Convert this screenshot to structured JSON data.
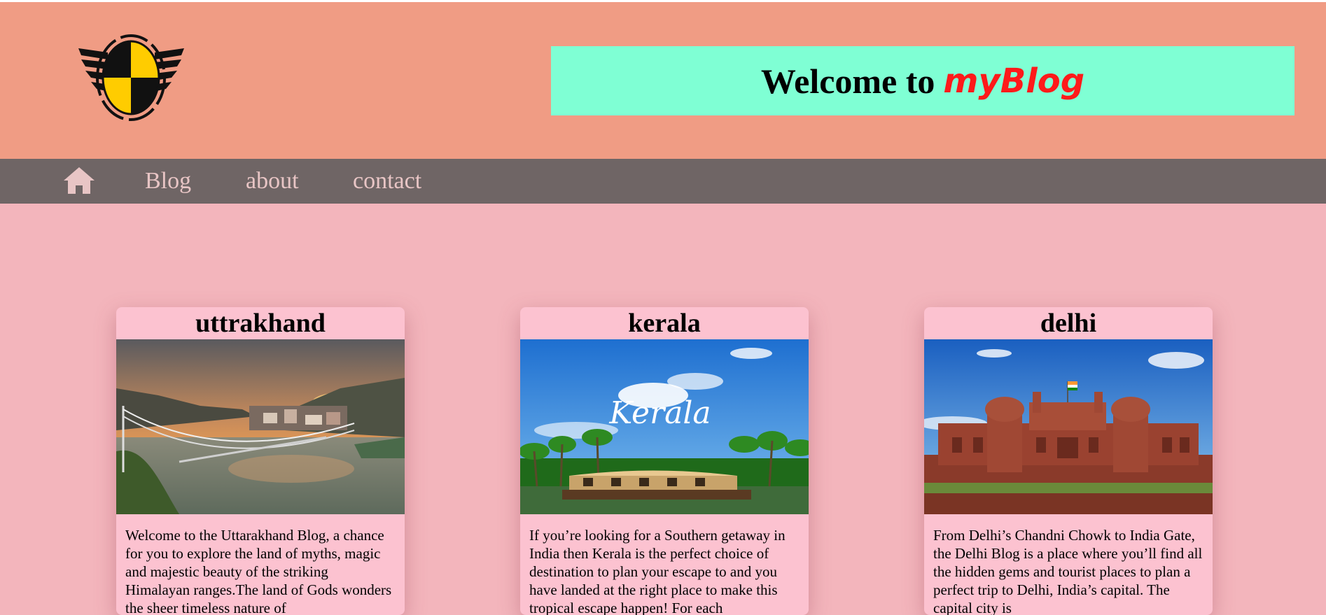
{
  "header": {
    "welcome_text": "Welcome to",
    "brand_name": "myBlog",
    "colors": {
      "header_bg": "#f09c84",
      "banner_bg": "#7fffd4",
      "brand": "#ff1a1a"
    }
  },
  "nav": {
    "home_icon": "home-icon",
    "links": [
      "Blog",
      "about",
      "contact"
    ],
    "colors": {
      "bg": "#6f6565",
      "text": "#e8c5c5"
    }
  },
  "cards": [
    {
      "title": "uttrakhand",
      "text": "Welcome to the Uttarakhand Blog, a chance for you to explore the land of myths, magic and majestic beauty of the striking Himalayan ranges.The land of Gods wonders the sheer timeless nature of"
    },
    {
      "title": "kerala",
      "text": "If you’re looking for a Southern getaway in India then Kerala is the perfect choice of destination to plan your escape to and you have landed at the right place to make this tropical escape happen! For each"
    },
    {
      "title": "delhi",
      "text": "From Delhi’s Chandni Chowk to India Gate, the Delhi Blog is a place where you’ll find all the hidden gems and tourist places to plan a perfect trip to Delhi, India’s capital. The capital city is"
    }
  ],
  "images": {
    "kerala_overlay_text": "Kerala"
  },
  "colors": {
    "page_bg": "#f3b5bc",
    "card_bg": "#fcc2d0"
  }
}
